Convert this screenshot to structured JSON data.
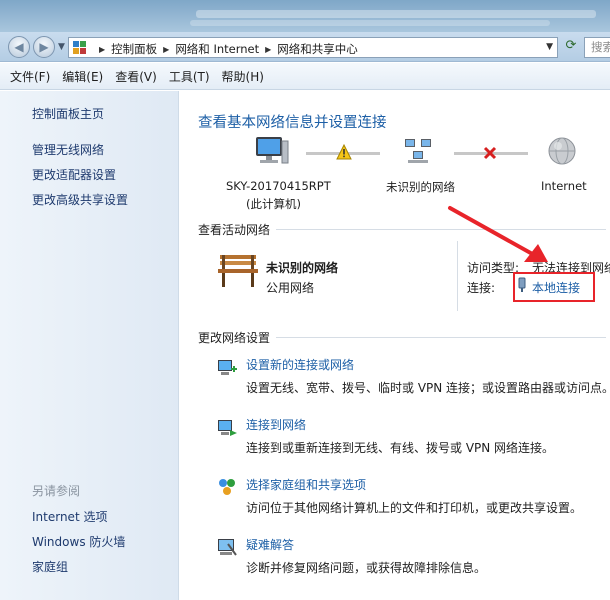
{
  "window": {
    "address": {
      "crumbs": [
        "控制面板",
        "网络和 Internet",
        "网络和共享中心"
      ],
      "search_placeholder": "搜索"
    },
    "menu": [
      "文件(F)",
      "编辑(E)",
      "查看(V)",
      "工具(T)",
      "帮助(H)"
    ]
  },
  "sidebar": {
    "home": "控制面板主页",
    "links": [
      "管理无线网络",
      "更改适配器设置",
      "更改高级共享设置"
    ],
    "see_also_heading": "另请参阅",
    "see_also": [
      "Internet 选项",
      "Windows 防火墙",
      "家庭组"
    ]
  },
  "main": {
    "title": "查看基本网络信息并设置连接",
    "map": {
      "computer_name": "SKY-20170415RPT",
      "computer_sub": "(此计算机)",
      "network": "未识别的网络",
      "internet": "Internet"
    },
    "active_heading": "查看活动网络",
    "active": {
      "name": "未识别的网络",
      "type": "公用网络",
      "access_label": "访问类型:",
      "access_value": "无法连接到网络",
      "conn_label": "连接:",
      "conn_value": "本地连接"
    },
    "change_heading": "更改网络设置",
    "tasks": [
      {
        "title": "设置新的连接或网络",
        "desc": "设置无线、宽带、拨号、临时或 VPN 连接；或设置路由器或访问点。"
      },
      {
        "title": "连接到网络",
        "desc": "连接到或重新连接到无线、有线、拨号或 VPN 网络连接。"
      },
      {
        "title": "选择家庭组和共享选项",
        "desc": "访问位于其他网络计算机上的文件和打印机，或更改共享设置。"
      },
      {
        "title": "疑难解答",
        "desc": "诊断并修复网络问题，或获得故障排除信息。"
      }
    ]
  },
  "colors": {
    "link": "#1d5fa6",
    "annotation": "#e8242a"
  }
}
